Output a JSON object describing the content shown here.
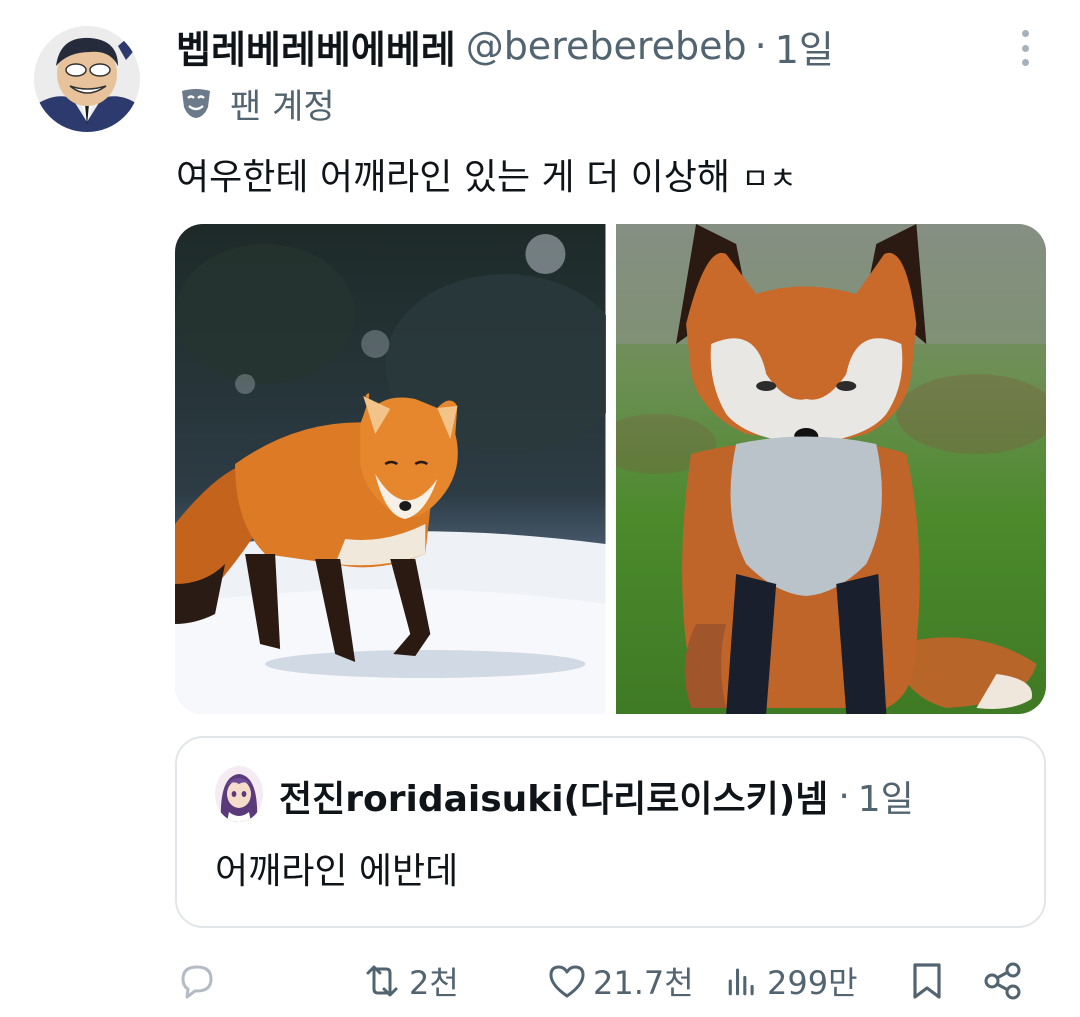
{
  "post": {
    "display_name": "벱레베레베에베레",
    "handle": "@bereberebeb",
    "separator": "·",
    "time": "1일",
    "badge_label": "팬 계정",
    "text_main": "여우한테 어깨라인 있는 게 더 이상해",
    "text_jamo": "ㅁㅊ",
    "photos": [
      {
        "description": "fox-walking-on-snow"
      },
      {
        "description": "fox-sitting-on-grass"
      }
    ]
  },
  "quote": {
    "display_name": "전진roridaisuki(다리로이스키)넴",
    "separator": "·",
    "time": "1일",
    "text": "어깨라인 에반데"
  },
  "actions": {
    "reply_count": "",
    "repost_count": "2천",
    "like_count": "21.7천",
    "view_count": "299만"
  },
  "colors": {
    "text_primary": "#0f1419",
    "text_secondary": "#536471",
    "border": "#e2e6e9",
    "fox_orange": "#d9691f"
  },
  "icons": [
    "more-vertical-icon",
    "fan-mask-icon",
    "reply-icon",
    "repost-icon",
    "like-icon",
    "views-icon",
    "bookmark-icon",
    "share-icon"
  ]
}
